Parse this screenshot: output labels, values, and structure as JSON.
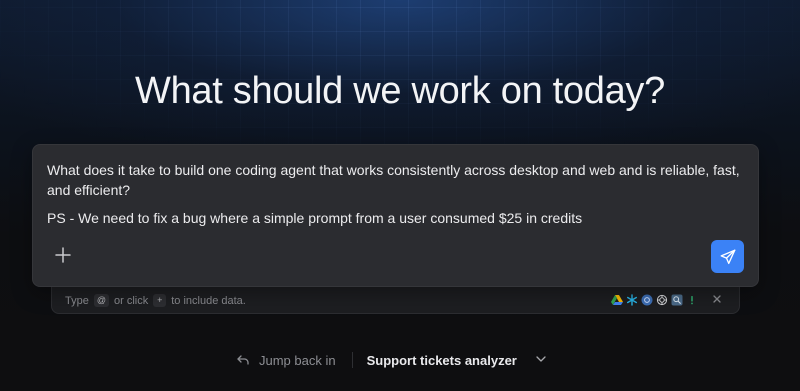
{
  "headline": "What should we work on today?",
  "composer": {
    "prompt_line1": "What does it take to build one coding agent that works consistently across desktop and web and is reliable, fast, and efficient?",
    "prompt_line2": "PS - We need to fix a bug where a simple prompt from a user consumed $25 in credits",
    "add_icon": "plus-icon",
    "send_icon": "send-icon",
    "accent_color": "#3b82f6"
  },
  "data_bar": {
    "hint_type": "Type",
    "hint_at": "@",
    "hint_or_click": "or click",
    "hint_plus": "+",
    "hint_suffix": "to include data.",
    "sources": [
      "google-drive-icon",
      "snowflake-icon",
      "postgres-icon",
      "openai-icon",
      "database-search-icon",
      "alert-icon"
    ],
    "close_icon": "close-icon"
  },
  "recent": {
    "jump_label": "Jump back in",
    "jump_icon": "undo-arrow-icon",
    "project_label": "Support tickets analyzer",
    "dropdown_icon": "chevron-down-icon"
  }
}
